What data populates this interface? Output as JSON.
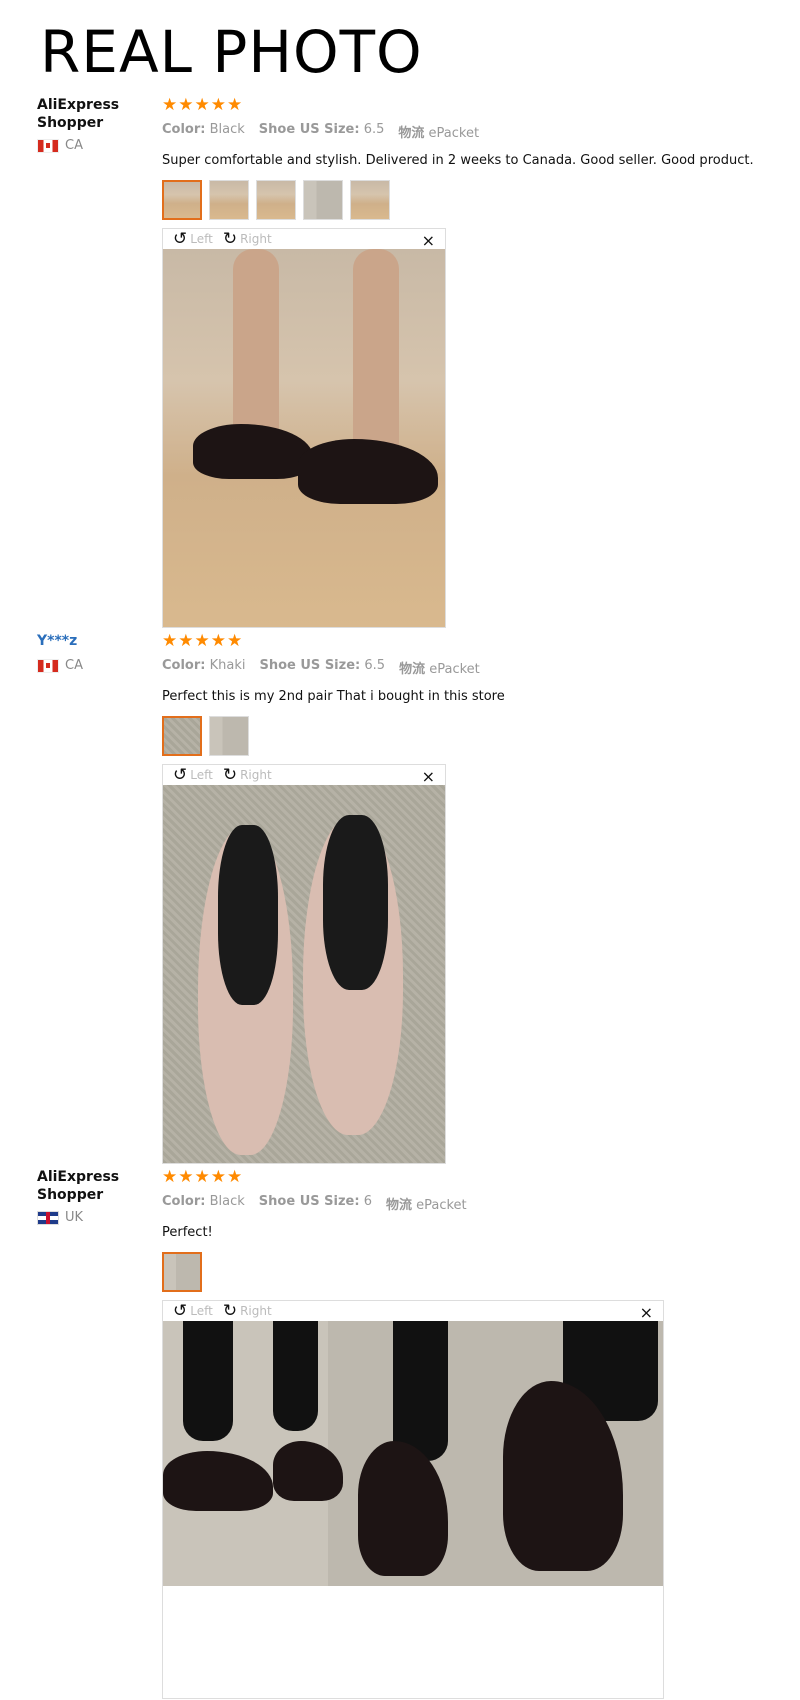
{
  "headline": "REAL PHOTO",
  "viewer_labels": {
    "rotate_left": "Left",
    "rotate_right": "Right",
    "close": "×"
  },
  "reviews": [
    {
      "user": "AliExpress Shopper",
      "country": "CA",
      "stars": 5,
      "color_label": "Color:",
      "color": "Black",
      "size_label": "Shoe US Size:",
      "size": "6.5",
      "shipping_label": "物流",
      "shipping": "ePacket",
      "comment": "Super comfortable and stylish. Delivered in 2 weeks to Canada. Good seller. Good product.",
      "thumb_count": 5
    },
    {
      "user": "Y***z",
      "country": "CA",
      "stars": 5,
      "color_label": "Color:",
      "color": "Khaki",
      "size_label": "Shoe US Size:",
      "size": "6.5",
      "shipping_label": "物流",
      "shipping": "ePacket",
      "comment": "Perfect this is my 2nd pair That i bought in this store",
      "thumb_count": 2
    },
    {
      "user": "AliExpress Shopper",
      "country": "UK",
      "stars": 5,
      "color_label": "Color:",
      "color": "Black",
      "size_label": "Shoe US Size:",
      "size": "6",
      "shipping_label": "物流",
      "shipping": "ePacket",
      "comment": "Perfect!",
      "thumb_count": 1
    }
  ],
  "colors": {
    "star": "#ff8a00",
    "active_thumb": "#e26e1b",
    "link_user": "#2a6ebb"
  }
}
